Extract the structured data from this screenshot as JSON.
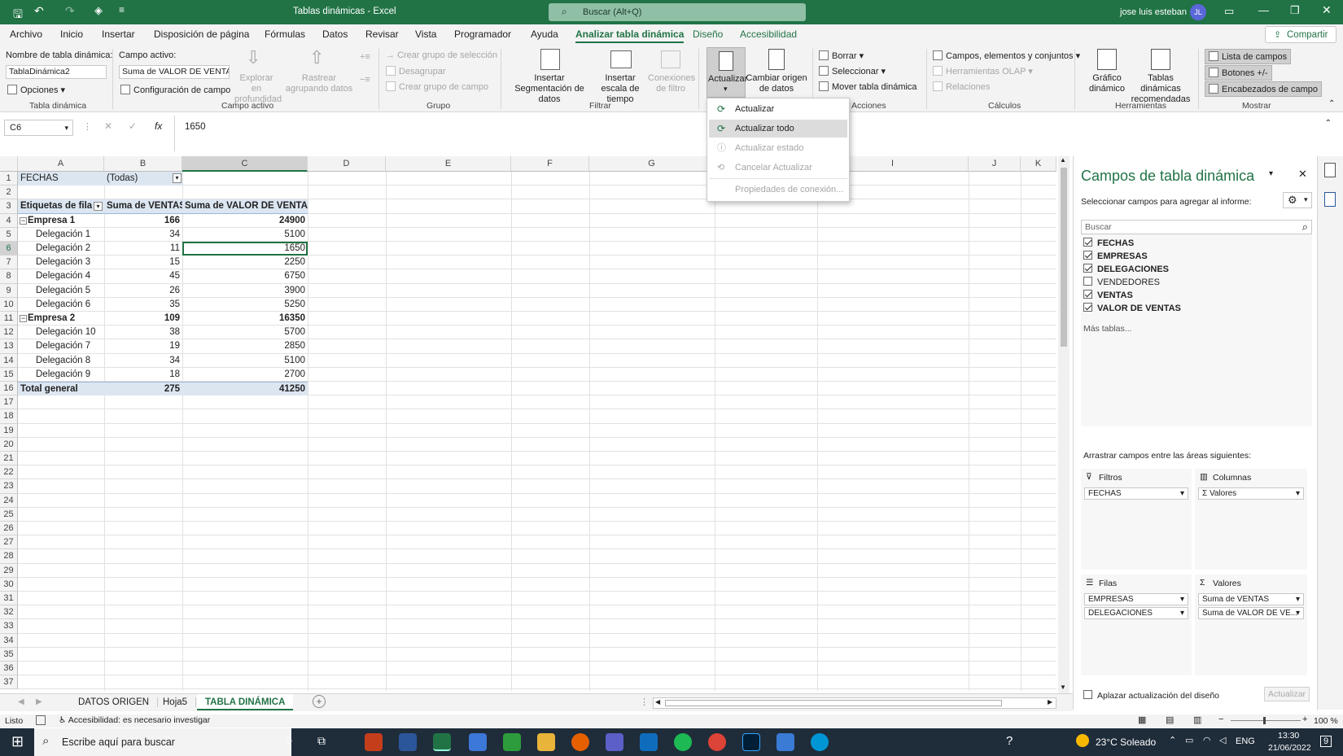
{
  "title_bar": {
    "doc_title": "Tablas dinámicas  -  Excel",
    "search_placeholder": "Buscar (Alt+Q)",
    "user_name": "jose luis esteban",
    "user_initials": "JL"
  },
  "menu": {
    "tabs": [
      "Archivo",
      "Inicio",
      "Insertar",
      "Disposición de página",
      "Fórmulas",
      "Datos",
      "Revisar",
      "Vista",
      "Programador",
      "Ayuda",
      "Analizar tabla dinámica",
      "Diseño",
      "Accesibilidad"
    ],
    "active_tab": "Analizar tabla dinámica",
    "share_label": "Compartir"
  },
  "ribbon": {
    "pt_name_label": "Nombre de tabla dinámica:",
    "pt_name_value": "TablaDinámica2",
    "options_label": "Opciones",
    "group_tabla": "Tabla dinámica",
    "active_field_label": "Campo activo:",
    "active_field_value": "Suma de VALOR DE VENTAS",
    "field_settings_label": "Configuración de campo",
    "drill_down": "Explorar en profundidad",
    "drill_up": "Rastrear agrupando datos",
    "group_campo": "Campo activo",
    "group_sel": "Crear grupo de selección",
    "ungroup": "Desagrupar",
    "group_field": "Crear grupo de campo",
    "group_grupo": "Grupo",
    "insert_slicer": "Insertar Segmentación de datos",
    "insert_timeline": "Insertar escala de tiempo",
    "filter_conn": "Conexiones de filtro",
    "group_filtrar": "Filtrar",
    "refresh": "Actualizar",
    "change_source": "Cambiar origen de datos",
    "clear": "Borrar",
    "select": "Seleccionar",
    "move_pt": "Mover tabla dinámica",
    "group_acciones": "Acciones",
    "fields_items": "Campos, elementos y conjuntos",
    "olap_tools": "Herramientas OLAP",
    "relations": "Relaciones",
    "group_calculos": "Cálculos",
    "pivot_chart": "Gráfico dinámico",
    "recommended": "Tablas dinámicas recomendadas",
    "group_herramientas": "Herramientas",
    "field_list": "Lista de campos",
    "buttons": "Botones +/-",
    "field_headers": "Encabezados de campo",
    "group_mostrar": "Mostrar"
  },
  "refresh_menu": {
    "items": [
      "Actualizar",
      "Actualizar todo",
      "Actualizar estado",
      "Cancelar Actualizar",
      "Propiedades de conexión..."
    ]
  },
  "formula_bar": {
    "name_box": "C6",
    "fx": "fx",
    "value": "1650"
  },
  "sheet": {
    "columns": [
      "A",
      "B",
      "C",
      "D",
      "E",
      "F",
      "G",
      "H",
      "I",
      "J",
      "K"
    ],
    "row_numbers": [
      "1",
      "2",
      "3",
      "4",
      "5",
      "6",
      "7",
      "8",
      "9",
      "10",
      "11",
      "12",
      "13",
      "14",
      "15",
      "16",
      "17",
      "18",
      "19",
      "20",
      "21",
      "22",
      "23",
      "24",
      "25",
      "26",
      "27",
      "28",
      "29",
      "30",
      "31",
      "32",
      "33",
      "34",
      "35",
      "36",
      "37"
    ],
    "filter_label": "FECHAS",
    "filter_value": "(Todas)",
    "headers": [
      "Etiquetas de fila",
      "Suma de VENTAS",
      "Suma de VALOR DE VENTAS"
    ],
    "rows": [
      {
        "label": "Empresa 1",
        "ventas": "166",
        "valor": "24900",
        "level": 0
      },
      {
        "label": "Delegación 1",
        "ventas": "34",
        "valor": "5100",
        "level": 1
      },
      {
        "label": "Delegación 2",
        "ventas": "11",
        "valor": "1650",
        "level": 1
      },
      {
        "label": "Delegación 3",
        "ventas": "15",
        "valor": "2250",
        "level": 1
      },
      {
        "label": "Delegación 4",
        "ventas": "45",
        "valor": "6750",
        "level": 1
      },
      {
        "label": "Delegación 5",
        "ventas": "26",
        "valor": "3900",
        "level": 1
      },
      {
        "label": "Delegación 6",
        "ventas": "35",
        "valor": "5250",
        "level": 1
      },
      {
        "label": "Empresa 2",
        "ventas": "109",
        "valor": "16350",
        "level": 0
      },
      {
        "label": "Delegación 10",
        "ventas": "38",
        "valor": "5700",
        "level": 1
      },
      {
        "label": "Delegación 7",
        "ventas": "19",
        "valor": "2850",
        "level": 1
      },
      {
        "label": "Delegación 8",
        "ventas": "34",
        "valor": "5100",
        "level": 1
      },
      {
        "label": "Delegación 9",
        "ventas": "18",
        "valor": "2700",
        "level": 1
      }
    ],
    "total": {
      "label": "Total general",
      "ventas": "275",
      "valor": "41250"
    },
    "sheet_tabs": [
      "DATOS ORIGEN",
      "Hoja5",
      "TABLA DINÁMICA"
    ],
    "active_sheet": "TABLA DINÁMICA"
  },
  "panel": {
    "title": "Campos de tabla dinámica",
    "subtitle": "Seleccionar campos para agregar al informe:",
    "search_placeholder": "Buscar",
    "fields": [
      {
        "name": "FECHAS",
        "checked": true
      },
      {
        "name": "EMPRESAS",
        "checked": true
      },
      {
        "name": "DELEGACIONES",
        "checked": true
      },
      {
        "name": "VENDEDORES",
        "checked": false
      },
      {
        "name": "VENTAS",
        "checked": true
      },
      {
        "name": "VALOR DE VENTAS",
        "checked": true
      }
    ],
    "more_tables": "Más tablas...",
    "drag_label": "Arrastrar campos entre las áreas siguientes:",
    "filters_title": "Filtros",
    "filters_items": [
      "FECHAS"
    ],
    "columns_title": "Columnas",
    "columns_items": [
      "Σ  Valores"
    ],
    "rows_title": "Filas",
    "rows_items": [
      "EMPRESAS",
      "DELEGACIONES"
    ],
    "values_title": "Valores",
    "values_items": [
      "Suma de VENTAS",
      "Suma de VALOR DE VE..."
    ],
    "defer_label": "Aplazar actualización del diseño",
    "update_button": "Actualizar"
  },
  "status": {
    "ready": "Listo",
    "accessibility": "Accesibilidad: es necesario investigar",
    "zoom": "100 %"
  },
  "taskbar": {
    "search_placeholder": "Escribe aquí para buscar",
    "weather": "23°C  Soleado",
    "lang": "ENG",
    "time": "13:30",
    "date": "21/06/2022",
    "notif_count": "9"
  },
  "colors": {
    "excel_green": "#217346",
    "pivot_header": "#dce6f1",
    "taskbar": "#1f2c3a"
  }
}
